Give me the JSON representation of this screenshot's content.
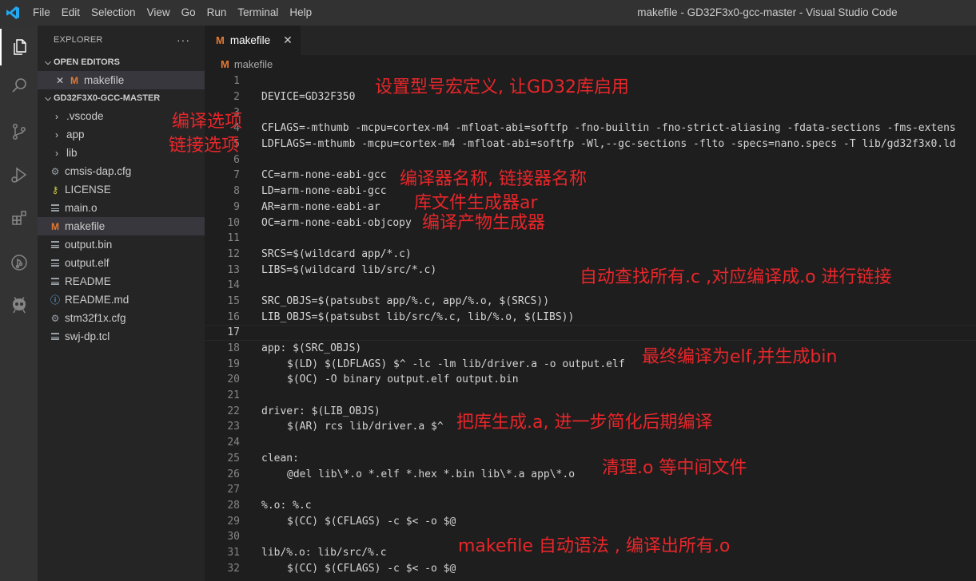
{
  "titlebar": {
    "menu": [
      "File",
      "Edit",
      "Selection",
      "View",
      "Go",
      "Run",
      "Terminal",
      "Help"
    ],
    "window_title": "makefile - GD32F3x0-gcc-master - Visual Studio Code"
  },
  "activity_bar": [
    "files-icon",
    "search-icon",
    "source-control-icon",
    "run-debug-icon",
    "extensions-icon",
    "git-graph-icon",
    "platformio-icon"
  ],
  "sidebar": {
    "header": "EXPLORER",
    "more": "···",
    "open_editors_title": "OPEN EDITORS",
    "open_editor_file": "makefile",
    "project_title": "GD32F3X0-GCC-MASTER",
    "items": [
      {
        "label": ".vscode",
        "type": "folder"
      },
      {
        "label": "app",
        "type": "folder"
      },
      {
        "label": "lib",
        "type": "folder"
      },
      {
        "label": "cmsis-dap.cfg",
        "type": "gear"
      },
      {
        "label": "LICENSE",
        "type": "key"
      },
      {
        "label": "main.o",
        "type": "lines"
      },
      {
        "label": "makefile",
        "type": "makefile"
      },
      {
        "label": "output.bin",
        "type": "lines"
      },
      {
        "label": "output.elf",
        "type": "lines"
      },
      {
        "label": "README",
        "type": "lines"
      },
      {
        "label": "README.md",
        "type": "info"
      },
      {
        "label": "stm32f1x.cfg",
        "type": "gear"
      },
      {
        "label": "swj-dp.tcl",
        "type": "lines"
      }
    ]
  },
  "editor": {
    "tab_label": "makefile",
    "breadcrumb": "makefile",
    "lines": [
      {
        "n": "1",
        "text": ""
      },
      {
        "n": "2",
        "text": "DEVICE=GD32F350"
      },
      {
        "n": "3",
        "text": ""
      },
      {
        "n": "4",
        "text": "CFLAGS=-mthumb -mcpu=cortex-m4 -mfloat-abi=softfp -fno-builtin -fno-strict-aliasing -fdata-sections -fms-extens"
      },
      {
        "n": "5",
        "text": "LDFLAGS=-mthumb -mcpu=cortex-m4 -mfloat-abi=softfp -Wl,--gc-sections -flto -specs=nano.specs -T lib/gd32f3x0.ld"
      },
      {
        "n": "6",
        "text": ""
      },
      {
        "n": "7",
        "text": "CC=arm-none-eabi-gcc"
      },
      {
        "n": "8",
        "text": "LD=arm-none-eabi-gcc"
      },
      {
        "n": "9",
        "text": "AR=arm-none-eabi-ar"
      },
      {
        "n": "10",
        "text": "OC=arm-none-eabi-objcopy"
      },
      {
        "n": "11",
        "text": ""
      },
      {
        "n": "12",
        "text": "SRCS=$(wildcard app/*.c)"
      },
      {
        "n": "13",
        "text": "LIBS=$(wildcard lib/src/*.c)"
      },
      {
        "n": "14",
        "text": ""
      },
      {
        "n": "15",
        "text": "SRC_OBJS=$(patsubst app/%.c, app/%.o, $(SRCS))"
      },
      {
        "n": "16",
        "text": "LIB_OBJS=$(patsubst lib/src/%.c, lib/%.o, $(LIBS))"
      },
      {
        "n": "17",
        "text": ""
      },
      {
        "n": "18",
        "text": "app: $(SRC_OBJS)"
      },
      {
        "n": "19",
        "text": "$(LD) $(LDFLAGS) $^ -lc -lm lib/driver.a -o output.elf",
        "indent": true
      },
      {
        "n": "20",
        "text": "$(OC) -O binary output.elf output.bin",
        "indent": true
      },
      {
        "n": "21",
        "text": ""
      },
      {
        "n": "22",
        "text": "driver: $(LIB_OBJS)"
      },
      {
        "n": "23",
        "text": "$(AR) rcs lib/driver.a $^",
        "indent": true
      },
      {
        "n": "24",
        "text": ""
      },
      {
        "n": "25",
        "text": "clean:"
      },
      {
        "n": "26",
        "text": "@del lib\\*.o *.elf *.hex *.bin lib\\*.a app\\*.o",
        "indent": true
      },
      {
        "n": "27",
        "text": ""
      },
      {
        "n": "28",
        "text": "%.o: %.c"
      },
      {
        "n": "29",
        "text": "$(CC) $(CFLAGS) -c $< -o $@",
        "indent": true
      },
      {
        "n": "30",
        "text": ""
      },
      {
        "n": "31",
        "text": "lib/%.o: lib/src/%.c"
      },
      {
        "n": "32",
        "text": "$(CC) $(CFLAGS) -c $< -o $@",
        "indent": true
      }
    ]
  },
  "annotations": {
    "device": "设置型号宏定义, 让GD32库启用",
    "compile_opts": "编译选项",
    "link_opts": "链接选项",
    "toolnames": "编译器名称, 链接器名称",
    "ar": "库文件生成器ar",
    "objcopy": "编译产物生成器",
    "objs": "自动查找所有.c ,对应编译成.o 进行链接",
    "app": "最终编译为elf,并生成bin",
    "driver": "把库生成.a, 进一步简化后期编译",
    "clean": "清理.o 等中间文件",
    "rules": "makefile 自动语法 , 编译出所有.o"
  }
}
